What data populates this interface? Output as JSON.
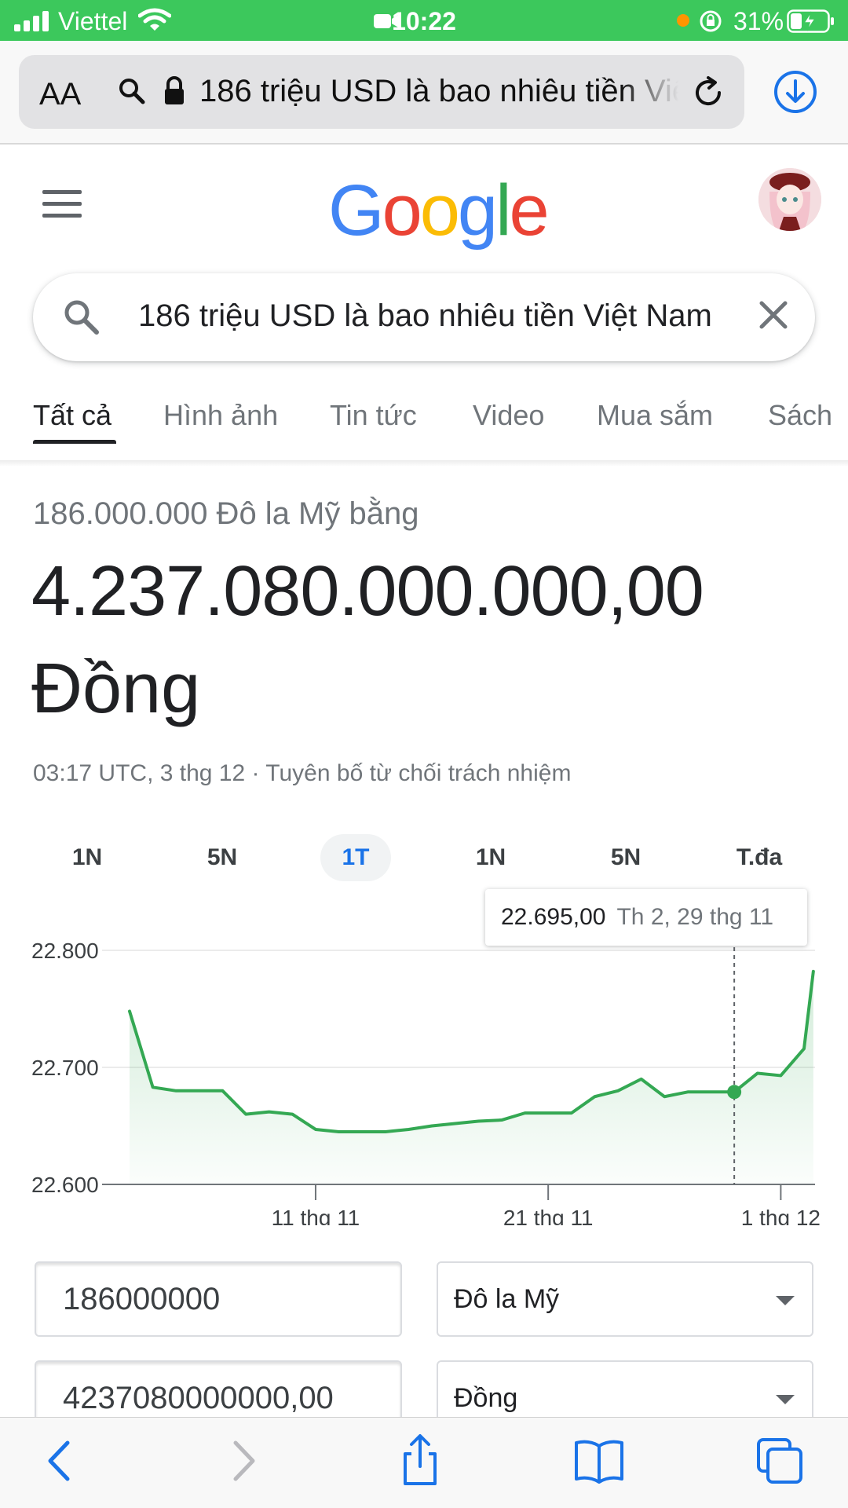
{
  "status_bar": {
    "carrier": "Viettel",
    "time": "10:22",
    "battery": "31%"
  },
  "browser": {
    "text_size_label": "AA",
    "url_text": "186 triệu USD là bao nhiêu tiền Việt Nam"
  },
  "google": {
    "logo_letters": [
      "G",
      "o",
      "o",
      "g",
      "l",
      "e"
    ],
    "logo_colors": [
      "#4285F4",
      "#EA4335",
      "#FBBC05",
      "#4285F4",
      "#34A853",
      "#EA4335"
    ]
  },
  "search": {
    "query": "186 triệu USD là bao nhiêu tiền Việt Nam"
  },
  "tabs": [
    "Tất cả",
    "Hình ảnh",
    "Tin tức",
    "Video",
    "Mua sắm",
    "Sách"
  ],
  "conversion": {
    "from_line": "186.000.000 Đô la Mỹ bằng",
    "result_value": "4.237.080.000.000,00",
    "result_unit": "Đồng",
    "timestamp": "03:17 UTC, 3 thg 12 · Tuyên bố từ chối trách nhiệm"
  },
  "ranges": [
    "1N",
    "5N",
    "1T",
    "1N",
    "5N",
    "T.đa"
  ],
  "active_range": "1T",
  "tooltip": {
    "value": "22.695,00",
    "date": "Th 2, 29 thg 11"
  },
  "chart_data": {
    "type": "area",
    "title": "",
    "xlabel": "",
    "ylabel": "",
    "ylim": [
      22600,
      22800
    ],
    "y_ticks": [
      "22.800",
      "22.700",
      "22.600"
    ],
    "y_tick_values": [
      22800,
      22700,
      22600
    ],
    "x_ticks": [
      "11 thg 11",
      "21 thg 11",
      "1 thg 12"
    ],
    "x_tick_values": [
      "2021-11-11",
      "2021-11-21",
      "2021-12-01"
    ],
    "x": [
      "2021-11-03",
      "2021-11-04",
      "2021-11-05",
      "2021-11-06",
      "2021-11-07",
      "2021-11-08",
      "2021-11-09",
      "2021-11-10",
      "2021-11-11",
      "2021-11-12",
      "2021-11-13",
      "2021-11-14",
      "2021-11-15",
      "2021-11-16",
      "2021-11-17",
      "2021-11-18",
      "2021-11-19",
      "2021-11-20",
      "2021-11-21",
      "2021-11-22",
      "2021-11-23",
      "2021-11-24",
      "2021-11-25",
      "2021-11-26",
      "2021-11-27",
      "2021-11-28",
      "2021-11-29",
      "2021-11-30",
      "2021-12-01",
      "2021-12-02"
    ],
    "values": [
      22748,
      22683,
      22680,
      22680,
      22680,
      22660,
      22662,
      22660,
      22647,
      22645,
      22645,
      22645,
      22647,
      22650,
      22652,
      22654,
      22655,
      22661,
      22661,
      22661,
      22675,
      22680,
      22690,
      22675,
      22679,
      22679,
      22679,
      22695,
      22693,
      22716
    ],
    "extra_end_value": 22782,
    "highlight_date": "2021-11-29",
    "line_color": "#34a853",
    "grid": true
  },
  "converter": {
    "amount_from": "186000000",
    "amount_to": "4237080000000,00",
    "currency_from": "Đô la Mỹ",
    "currency_to": "Đồng"
  }
}
